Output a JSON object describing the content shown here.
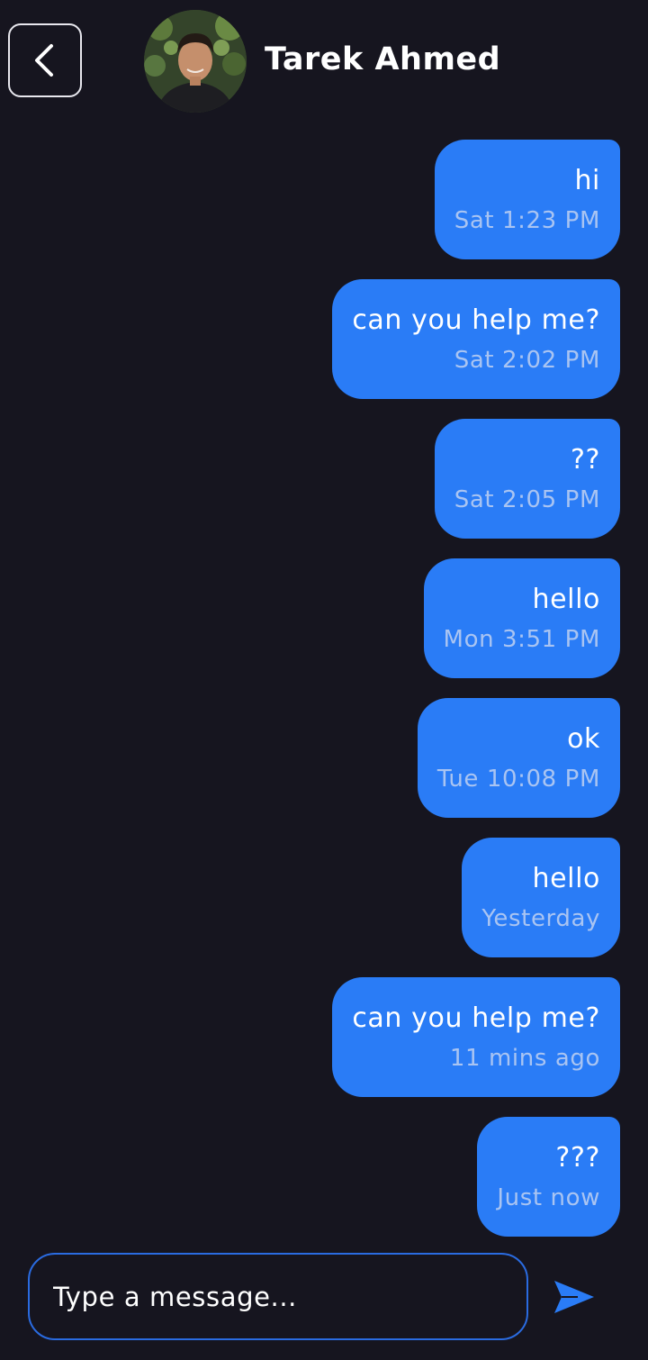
{
  "header": {
    "contact_name": "Tarek Ahmed",
    "back_icon": "chevron-left-icon"
  },
  "messages": [
    {
      "text": "hi",
      "time": "Sat 1:23 PM"
    },
    {
      "text": "can you help me?",
      "time": "Sat 2:02 PM"
    },
    {
      "text": "??",
      "time": "Sat 2:05 PM"
    },
    {
      "text": "hello",
      "time": "Mon 3:51 PM"
    },
    {
      "text": "ok",
      "time": "Tue 10:08 PM"
    },
    {
      "text": "hello",
      "time": "Yesterday"
    },
    {
      "text": "can you help me?",
      "time": "11 mins ago"
    },
    {
      "text": "???",
      "time": "Just now"
    }
  ],
  "composer": {
    "placeholder": "Type a message...",
    "value": "",
    "send_icon": "send-icon"
  },
  "colors": {
    "background": "#16151f",
    "bubble": "#2a7cf6",
    "timestamp": "#a9c4f2",
    "composer_border": "#2a6be0"
  }
}
